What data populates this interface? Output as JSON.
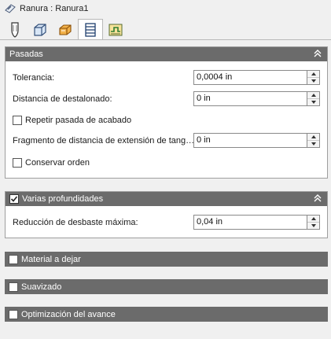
{
  "title": {
    "text": "Ranura : Ranura1",
    "icon": "slot-feature-icon"
  },
  "tabs": [
    {
      "icon": "tool-bit-icon",
      "active": false
    },
    {
      "icon": "stock-box-icon",
      "active": false
    },
    {
      "icon": "geometry-layers-icon",
      "active": false
    },
    {
      "icon": "passes-icon",
      "active": true
    },
    {
      "icon": "linking-icon",
      "active": false
    }
  ],
  "pasadas": {
    "header": "Pasadas",
    "tolerancia_label": "Tolerancia:",
    "tolerancia_value": "0,0004 in",
    "destalonado_label": "Distancia de destalonado:",
    "destalonado_value": "0 in",
    "repetir_label": "Repetir pasada de acabado",
    "repetir_checked": false,
    "fragmento_label": "Fragmento de distancia de extensión de tang…",
    "fragmento_value": "0 in",
    "conservar_label": "Conservar orden",
    "conservar_checked": false
  },
  "varias": {
    "header": "Varias profundidades",
    "checked": true,
    "reduccion_label": "Reducción de desbaste máxima:",
    "reduccion_value": "0,04 in"
  },
  "material": {
    "header": "Material a dejar",
    "checked": false
  },
  "suavizado": {
    "header": "Suavizado",
    "checked": false
  },
  "optimizacion": {
    "header": "Optimización del avance",
    "checked": false
  },
  "colors": {
    "header_bg": "#6b6b6b",
    "panel_bg": "#ffffff",
    "page_bg": "#f0f0f0"
  }
}
